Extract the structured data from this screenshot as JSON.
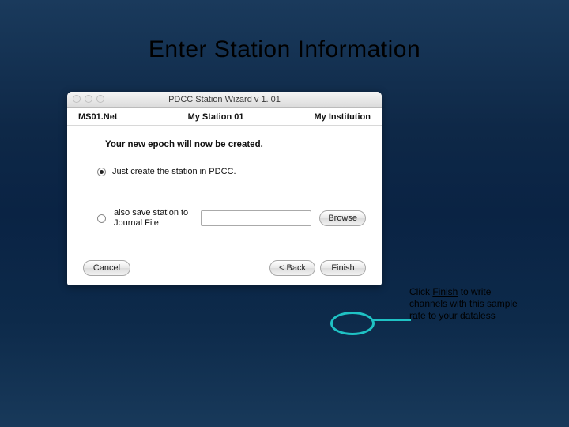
{
  "slide": {
    "title": "Enter Station Information"
  },
  "window": {
    "title": "PDCC Station Wizard v 1. 01",
    "header": {
      "network": "MS01.Net",
      "station": "My Station 01",
      "institution": "My Institution"
    },
    "message": "Your new epoch will now be created.",
    "options": {
      "create_only": "Just create the station in PDCC.",
      "save_journal": "also save station to Journal File",
      "browse": "Browse"
    },
    "buttons": {
      "cancel": "Cancel",
      "back": "< Back",
      "finish": "Finish"
    }
  },
  "annotation": {
    "pre": "Click ",
    "emph": "Finish",
    "post": " to write channels with this sample rate to your dataless"
  }
}
